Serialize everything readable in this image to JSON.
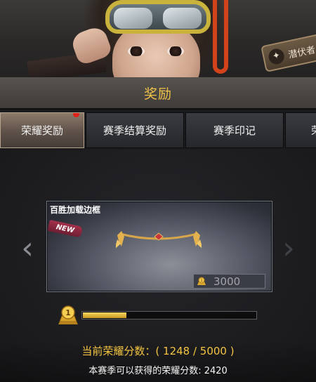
{
  "banner": {
    "badge_label": "潜伏者"
  },
  "title": "奖励",
  "tabs": [
    {
      "label": "荣耀奖励",
      "active": true,
      "has_notification": true
    },
    {
      "label": "赛季结算奖励",
      "active": false
    },
    {
      "label": "赛季印记",
      "active": false
    },
    {
      "label": "荣",
      "active": false
    }
  ],
  "reward": {
    "name": "百胜加载边框",
    "tag": "NEW",
    "price": "3000",
    "price_icon": "honor-coin-icon"
  },
  "progress": {
    "level": "1",
    "current": 1248,
    "max": 5000,
    "fraction": 0.25
  },
  "footer": {
    "current_score_text": "当前荣耀分数：( 1248 / 5000 )",
    "season_score_text": "本赛季可以获得的荣耀分数: 2420"
  },
  "colors": {
    "accent_gold": "#f3c441",
    "tab_active": "#8d7a6a",
    "notification": "#e0231a"
  }
}
